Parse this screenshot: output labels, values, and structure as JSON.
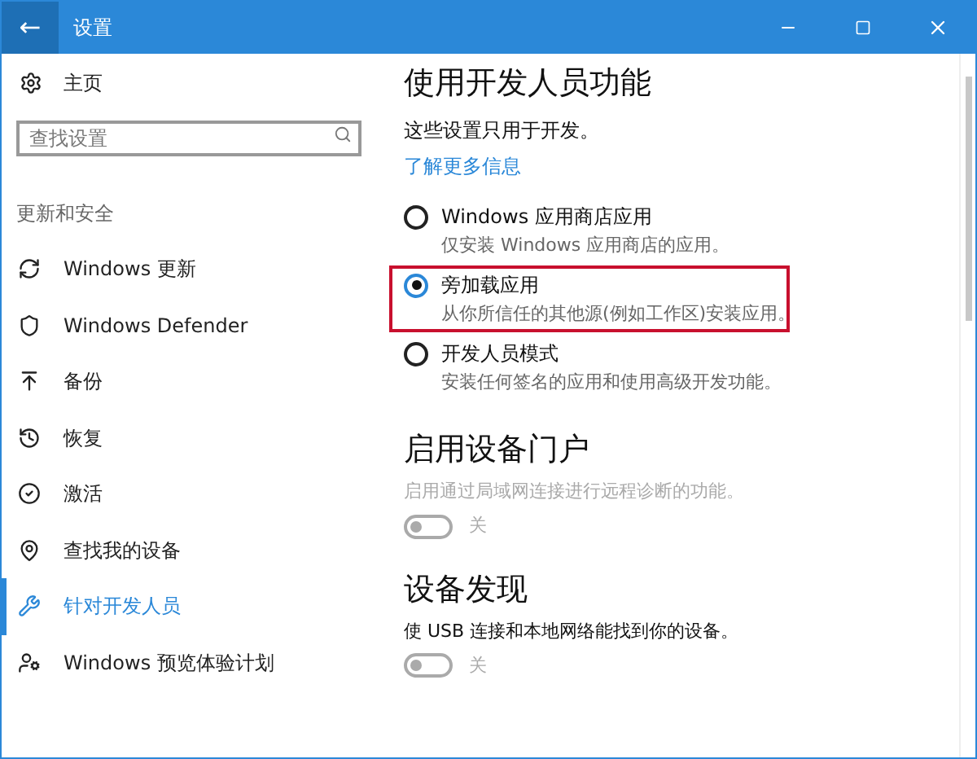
{
  "window": {
    "title": "设置",
    "back": "←"
  },
  "sidebar": {
    "home": "主页",
    "search": {
      "placeholder": "查找设置"
    },
    "section": "更新和安全",
    "items": [
      {
        "label": "Windows 更新",
        "selected": false
      },
      {
        "label": "Windows Defender",
        "selected": false
      },
      {
        "label": "备份",
        "selected": false
      },
      {
        "label": "恢复",
        "selected": false
      },
      {
        "label": "激活",
        "selected": false
      },
      {
        "label": "查找我的设备",
        "selected": false
      },
      {
        "label": "针对开发人员",
        "selected": true
      },
      {
        "label": "Windows 预览体验计划",
        "selected": false
      }
    ]
  },
  "developer": {
    "title": "使用开发人员功能",
    "note": "这些设置只用于开发。",
    "link": "了解更多信息",
    "options": [
      {
        "label": "Windows 应用商店应用",
        "description": "仅安装 Windows 应用商店的应用。",
        "selected": false,
        "highlighted": false
      },
      {
        "label": "旁加载应用",
        "description": "从你所信任的其他源(例如工作区)安装应用。",
        "selected": true,
        "highlighted": true
      },
      {
        "label": "开发人员模式",
        "description": "安装任何签名的应用和使用高级开发功能。",
        "selected": false,
        "highlighted": false
      }
    ]
  },
  "sections": [
    {
      "title": "启用设备门户",
      "description": "启用通过局域网连接进行远程诊断的功能。",
      "disabled": true,
      "toggle": {
        "on": false,
        "label": "关"
      }
    },
    {
      "title": "设备发现",
      "description": "使 USB 连接和本地网络能找到你的设备。",
      "disabled": false,
      "toggle": {
        "on": false,
        "label": "关"
      }
    }
  ]
}
